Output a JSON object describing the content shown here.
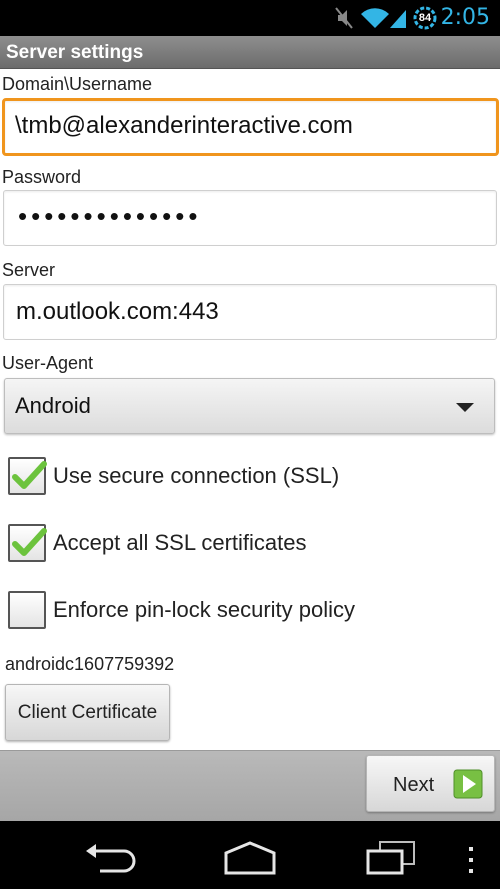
{
  "status_bar": {
    "time": "2:05",
    "battery": "84",
    "icons": [
      "mute-icon",
      "wifi-icon",
      "signal-icon",
      "battery-icon"
    ]
  },
  "title": "Server settings",
  "fields": {
    "username": {
      "label": "Domain\\Username",
      "value": "\\tmb@alexanderinteractive.com"
    },
    "password": {
      "label": "Password",
      "masked_value": "••••••••••••••"
    },
    "server": {
      "label": "Server",
      "value": "m.outlook.com:443"
    },
    "user_agent": {
      "label": "User-Agent",
      "selected": "Android"
    }
  },
  "checkboxes": [
    {
      "label": "Use secure connection (SSL)",
      "checked": true
    },
    {
      "label": "Accept all SSL certificates",
      "checked": true
    },
    {
      "label": "Enforce pin-lock security policy",
      "checked": false
    }
  ],
  "certificate": {
    "id": "androidc1607759392",
    "button_label": "Client Certificate"
  },
  "next_button": {
    "label": "Next"
  },
  "nav_bar": {
    "icons": [
      "back-icon",
      "home-icon",
      "recent-apps-icon",
      "menu-icon"
    ]
  },
  "colors": {
    "accent_clock": "#33b5e5",
    "focus_border": "#f0951d",
    "check_green": "#6cc33d",
    "next_icon_green": "#78c043"
  }
}
